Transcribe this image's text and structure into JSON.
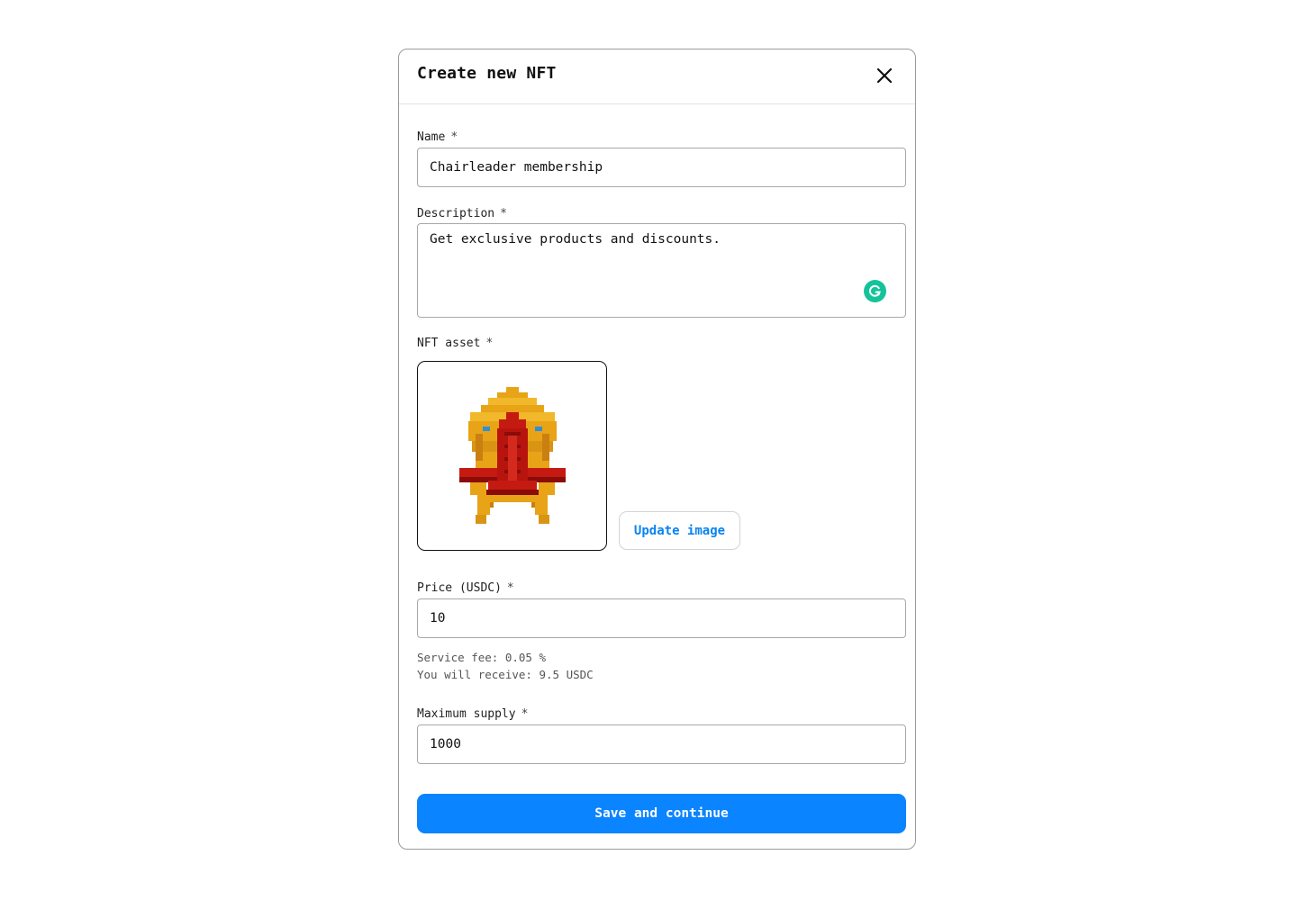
{
  "modal": {
    "title": "Create new NFT"
  },
  "fields": {
    "name": {
      "label": "Name",
      "required": "*",
      "value": "Chairleader membership"
    },
    "description": {
      "label": "Description",
      "required": "*",
      "value": "Get exclusive products and discounts."
    },
    "asset": {
      "label": "NFT asset",
      "required": "*",
      "update_label": "Update image"
    },
    "price": {
      "label": "Price (USDC)",
      "required": "*",
      "value": "10"
    },
    "supply": {
      "label": "Maximum supply",
      "required": "*",
      "value": "1000"
    }
  },
  "fee": {
    "service_fee": "Service fee: 0.05 %",
    "receive": "You will receive: 9.5 USDC"
  },
  "actions": {
    "save_label": "Save and continue"
  },
  "icons": {
    "close": "close-icon",
    "grammarly": "grammarly-icon",
    "asset": "throne-pixel-art"
  },
  "colors": {
    "accent": "#0a84ff",
    "grammarly": "#15c39a"
  }
}
